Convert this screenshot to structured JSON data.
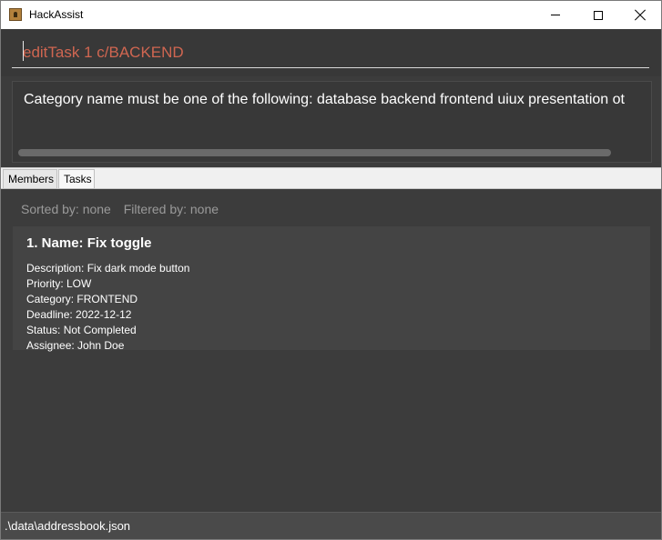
{
  "window": {
    "title": "HackAssist",
    "icon": "app-icon"
  },
  "command_box": {
    "value": "editTask 1 c/BACKEND",
    "text_color": "#d06651"
  },
  "result_display": {
    "message": "Category name must be one of the following:  database backend frontend uiux presentation ot"
  },
  "tabs": [
    {
      "label": "Members",
      "selected": false
    },
    {
      "label": "Tasks",
      "selected": true
    }
  ],
  "task_list": {
    "sorted_by": "Sorted by: none",
    "filtered_by": "Filtered by: none",
    "tasks": [
      {
        "title": "1. Name: Fix toggle",
        "description": "Description: Fix dark mode button",
        "priority": "Priority: LOW",
        "category": "Category: FRONTEND",
        "deadline": "Deadline: 2022-12-12",
        "status": "Status: Not Completed",
        "assignee": "Assignee: John Doe"
      }
    ]
  },
  "status_bar": {
    "path": ".\\data\\addressbook.json"
  },
  "colors": {
    "background": "#3c3c3c",
    "card": "#444444",
    "error_text": "#d06651"
  }
}
